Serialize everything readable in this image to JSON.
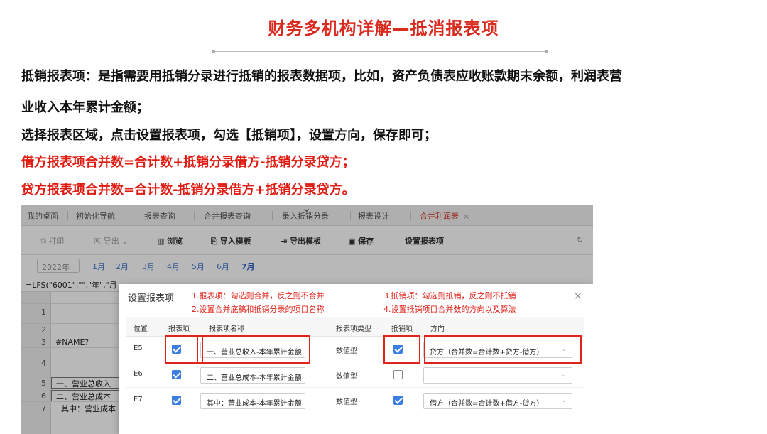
{
  "title": "财务多机构详解—抵消报表项",
  "paragraphs": [
    "抵销报表项：是指需要用抵销分录进行抵销的报表数据项，比如，资产负债表应收账款期末余额，利润表营",
    "业收入本年累计金额；",
    "选择报表区域，点击设置报表项，勾选【抵销项】，设置方向，保存即可；",
    "借方报表项合并数=合计数+抵销分录借方-抵销分录贷方；",
    "贷方报表项合并数=合计数-抵销分录借方+抵销分录贷方。"
  ],
  "colors": {
    "accent": "#d92b1f",
    "link": "#2d5fc4",
    "checkbox": "#3a7ee0"
  },
  "screenshot": {
    "tabs": [
      "我的桌面",
      "初始化导航",
      "报表查询",
      "合并报表查询",
      "录入抵销分录",
      "报表设计",
      "合并利润表"
    ],
    "active_tab": "合并利润表",
    "tab_close": "×",
    "toolbar": {
      "print": "打印",
      "export": "导出",
      "browse": "浏览",
      "import_template": "导入模板",
      "export_template": "导出模板",
      "save": "保存",
      "set_report_item": "设置报表项"
    },
    "year": "2022年",
    "months": [
      "1月",
      "2月",
      "3月",
      "4月",
      "5月",
      "6月",
      "7月"
    ],
    "active_month": "7月",
    "formula": "=LFS(\"6001\",\"\",\"年\",\"月",
    "row_numbers": [
      "1",
      "2",
      "3",
      "4",
      "5",
      "6",
      "7"
    ],
    "cells": [
      "#NAME?",
      "一、营业总收入",
      "二、营业总成本",
      "其中：营业成本"
    ],
    "modal": {
      "title": "设置报表项",
      "close": "×",
      "annotations": [
        "1.报表项：勾选则合并，反之则不合并",
        "2.设置合并底稿和抵销分录的项目名称",
        "3.抵销项：勾选则抵销，反之则不抵销",
        "4.设置抵销项目合并数的方向以及算法"
      ],
      "headers": [
        "位置",
        "报表项",
        "报表项名称",
        "报表项类型",
        "抵销项",
        "方向"
      ],
      "rows": [
        {
          "pos": "E5",
          "item": true,
          "name": "一、营业总收入-本年累计金额",
          "type": "数值型",
          "offset": true,
          "direction": "贷方（合并数=合计数+贷方-借方）"
        },
        {
          "pos": "E6",
          "item": true,
          "name": "二、营业总成本-本年累计金额",
          "type": "数值型",
          "offset": false,
          "direction": ""
        },
        {
          "pos": "E7",
          "item": true,
          "name": "其中：营业成本-本年累计金额",
          "type": "数值型",
          "offset": true,
          "direction": "借方（合并数=合计数+借方-贷方）"
        }
      ]
    }
  }
}
